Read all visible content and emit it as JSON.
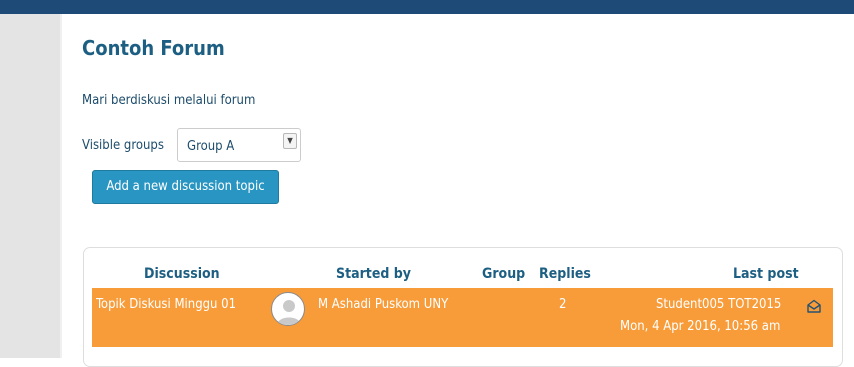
{
  "forum": {
    "title": "Contoh Forum",
    "description": "Mari berdiskusi melalui forum"
  },
  "groups": {
    "label": "Visible groups",
    "selected": "Group A"
  },
  "actions": {
    "add_topic": "Add a new discussion topic"
  },
  "table": {
    "headers": {
      "discussion": "Discussion",
      "started_by": "Started by",
      "group": "Group",
      "replies": "Replies",
      "last_post": "Last post"
    },
    "rows": [
      {
        "discussion": "Topik Diskusi Minggu 01",
        "started_by": "M Ashadi Puskom UNY",
        "group": "",
        "replies": "2",
        "last_post_author": "Student005 TOT2015",
        "last_post_date": "Mon, 4 Apr 2016, 10:56 am"
      }
    ]
  },
  "colors": {
    "header_bar": "#1e4a77",
    "title": "#1d5f83",
    "button": "#2995c2",
    "highlight_row": "#f89c3a"
  },
  "icons": {
    "avatar": "user-avatar-icon",
    "subscribe": "envelope-subscribe-icon",
    "dropdown": "chevron-down-icon"
  }
}
